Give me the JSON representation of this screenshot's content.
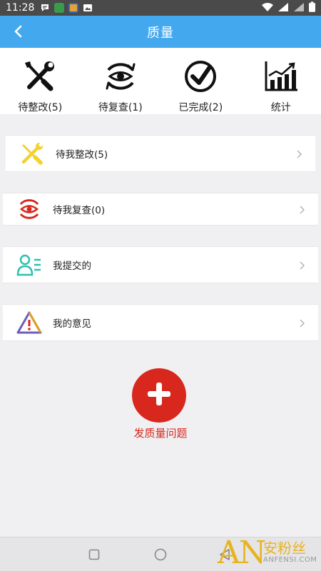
{
  "status_bar": {
    "time": "11:28"
  },
  "app_bar": {
    "title": "质量",
    "back_icon": "back-arrow-icon"
  },
  "top_nav": [
    {
      "label": "待整改(5)",
      "icon": "wrench-screwdriver-icon"
    },
    {
      "label": "待复查(1)",
      "icon": "eye-refresh-icon"
    },
    {
      "label": "已完成(2)",
      "icon": "checkmark-circle-icon"
    },
    {
      "label": "统计",
      "icon": "bar-chart-icon"
    }
  ],
  "list": [
    {
      "label": "待我整改(5)",
      "icon": "wrench-screwdriver-icon",
      "color": "#f2d22e"
    },
    {
      "label": "待我复查(0)",
      "icon": "eye-refresh-icon",
      "color": "#d8271d"
    },
    {
      "label": "我提交的",
      "icon": "user-list-icon",
      "color": "#2ec0b0"
    },
    {
      "label": "我的意见",
      "icon": "warning-triangle-icon",
      "color": "#e0a21e"
    }
  ],
  "fab": {
    "label": "发质量问题",
    "color": "#d8271d"
  },
  "colors": {
    "accent": "#44a8ef",
    "danger": "#d8271d"
  },
  "watermark": {
    "logo": "AN",
    "text_cn": "安粉丝",
    "text_en": "ANFENSI.COM"
  }
}
